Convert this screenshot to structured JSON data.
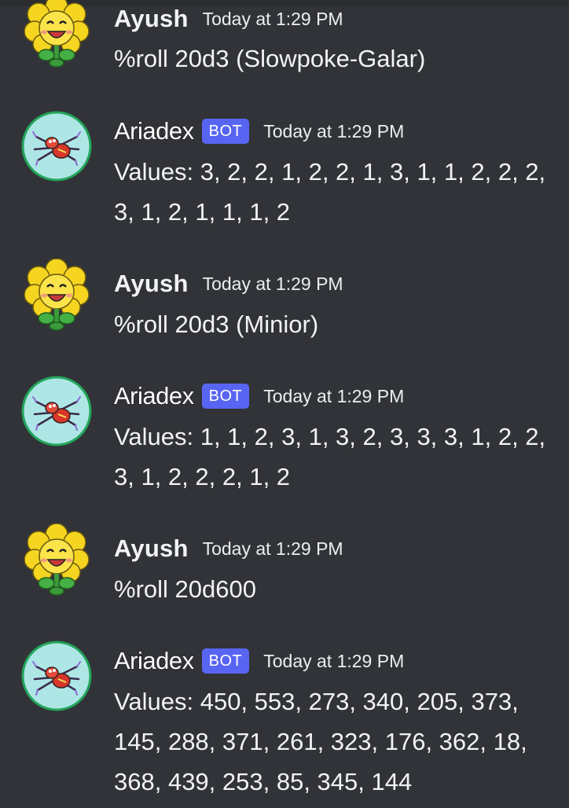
{
  "messages": [
    {
      "author": "Ayush",
      "is_bot": false,
      "avatar_icon": "sunflower-avatar-icon",
      "timestamp": "Today at 1:29 PM",
      "text": "%roll 20d3 (Slowpoke-Galar)"
    },
    {
      "author": "Ariadex",
      "is_bot": true,
      "bot_tag": "BOT",
      "avatar_icon": "spider-avatar-icon",
      "timestamp": "Today at 1:29 PM",
      "text": "Values: 3, 2, 2, 1, 2, 2, 1, 3, 1, 1, 2, 2, 2, 3, 1, 2, 1, 1, 1, 2"
    },
    {
      "author": "Ayush",
      "is_bot": false,
      "avatar_icon": "sunflower-avatar-icon",
      "timestamp": "Today at 1:29 PM",
      "text": "%roll 20d3 (Minior)"
    },
    {
      "author": "Ariadex",
      "is_bot": true,
      "bot_tag": "BOT",
      "avatar_icon": "spider-avatar-icon",
      "timestamp": "Today at 1:29 PM",
      "text": "Values: 1, 1, 2, 3, 1, 3, 2, 3, 3, 3, 1, 2, 2, 3, 1, 2, 2, 2, 1, 2"
    },
    {
      "author": "Ayush",
      "is_bot": false,
      "avatar_icon": "sunflower-avatar-icon",
      "timestamp": "Today at 1:29 PM",
      "text": "%roll 20d600"
    },
    {
      "author": "Ariadex",
      "is_bot": true,
      "bot_tag": "BOT",
      "avatar_icon": "spider-avatar-icon",
      "timestamp": "Today at 1:29 PM",
      "text": "Values: 450, 553, 273, 340, 205, 373, 145, 288, 371, 261, 323, 176, 362, 18, 368, 439, 253, 85, 345, 144"
    }
  ],
  "colors": {
    "background": "#313338",
    "bot_tag": "#5865f2",
    "avatar_ring": "#23a55a"
  }
}
